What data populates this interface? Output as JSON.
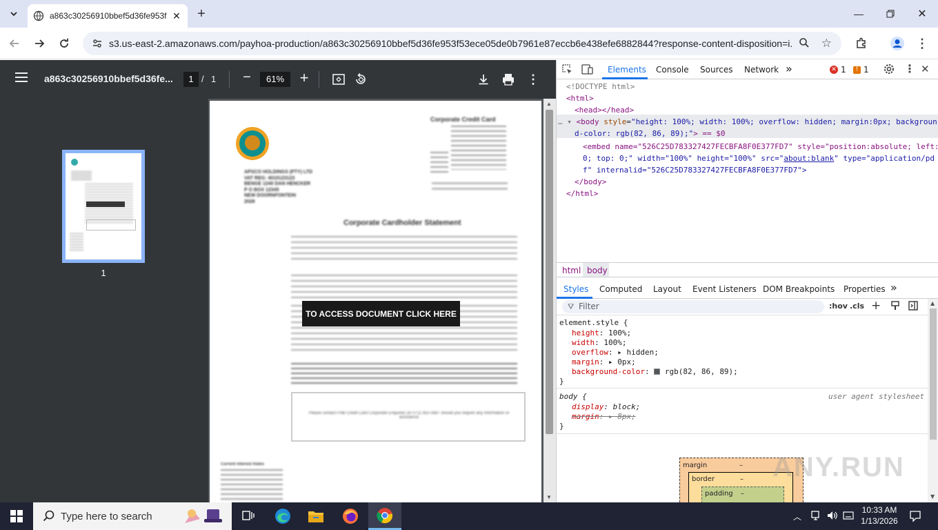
{
  "browser": {
    "tab_title": "a863c30256910bbef5d36fe953f",
    "url": "s3.us-east-2.amazonaws.com/payhoa-production/a863c30256910bbef5d36fe953f53ece05de0b7961e87eccb6e438efe6882844?response-content-disposition=i..."
  },
  "pdf": {
    "title": "a863c30256910bbef5d36fe...",
    "page_current": "1",
    "page_sep": "/",
    "page_total": "1",
    "zoom": "61%",
    "thumb_label": "1",
    "document": {
      "header_title": "Corporate Credit Card",
      "company_lines": [
        "APSCO HOLDINGS (PTY) LTD",
        "VAT REG: 4010123123",
        "BENGE 1240 DAN HENCKER",
        "P O BOX 12345",
        "NEW DOORNFONTEIN",
        "2028"
      ],
      "statement_title": "Corporate Cardholder Statement",
      "cta_label": "TO ACCESS DOCUMENT CLICK HERE",
      "footer_note": "Please contact FNB Credit Card Corporate Enquiries on 0711 953 5687 should you require any information or assistance",
      "interest_title": "Current Interest Rates"
    }
  },
  "devtools": {
    "tabs": [
      "Elements",
      "Console",
      "Sources",
      "Network"
    ],
    "more_tabs": "»",
    "errors": "1",
    "warnings": "1",
    "dom": {
      "doctype": "<!DOCTYPE html>",
      "html_open": "<html>",
      "head": "<head></head>",
      "body_tag": "body",
      "body_attr_name": "style",
      "body_attr_val": "\"height: 100%; width: 100%; overflow: hidden; margin:0px; backgroun",
      "body_attr_val2": "d-color: rgb(82, 86, 89);\"",
      "body_eq": "> == $0",
      "embed_l1": "<embed name=\"526C25D783327427FECBFA8F0E377FD7\" style=\"position:absolute; left:",
      "embed_l2a": "0; top: 0;\" width=\"100%\" height=\"100%\" src=\"",
      "embed_link": "about:blank",
      "embed_l2b": "\" type=\"application/pd",
      "embed_l3": "f\" internalid=\"526C25D783327427FECBFA8F0E377FD7\">",
      "body_close": "</body>",
      "html_close": "</html>"
    },
    "crumbs": [
      "html",
      "body"
    ],
    "subtabs": [
      "Styles",
      "Computed",
      "Layout",
      "Event Listeners",
      "DOM Breakpoints",
      "Properties"
    ],
    "filter_placeholder": "Filter",
    "hov": ":hov",
    "cls": ".cls",
    "styles": {
      "element_selector": "element.style {",
      "props": [
        {
          "name": "height",
          "value": "100%;"
        },
        {
          "name": "width",
          "value": "100%;"
        },
        {
          "name": "overflow",
          "value": "hidden;",
          "expand": true
        },
        {
          "name": "margin",
          "value": "0px;",
          "expand": true
        },
        {
          "name": "background-color",
          "value": "rgb(82, 86, 89);",
          "swatch": "#525659"
        }
      ],
      "close": "}",
      "ua_selector": "body {",
      "ua_source": "user agent stylesheet",
      "ua_props": [
        {
          "name": "display",
          "value": "block;"
        },
        {
          "name": "margin",
          "value": "8px;",
          "struck": true
        }
      ]
    },
    "boxmodel": {
      "margin": "margin",
      "border": "border",
      "padding": "padding",
      "dash": "–"
    }
  },
  "watermark": "ANY.RUN",
  "taskbar": {
    "search_placeholder": "Type here to search",
    "time": "10:33 AM",
    "date": "1/13/2026"
  }
}
